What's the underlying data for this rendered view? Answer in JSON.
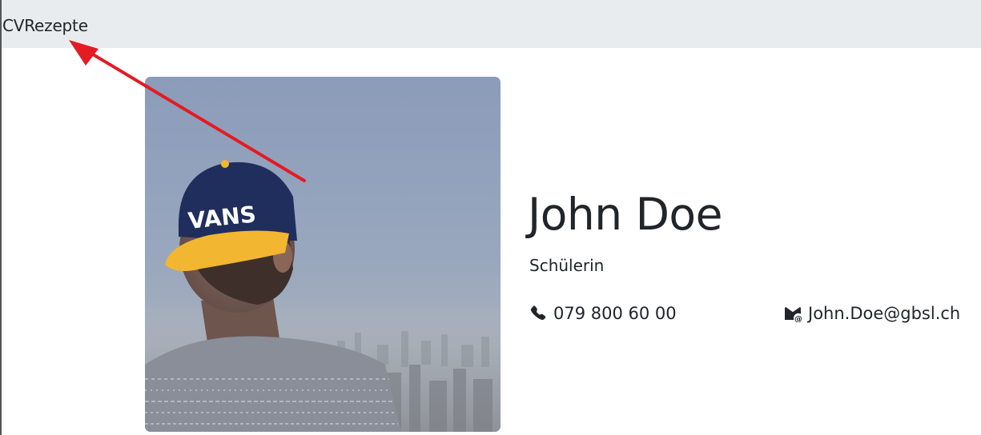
{
  "navbar": {
    "brand": "CVRezepte"
  },
  "profile": {
    "photo_icon": "profile-photo",
    "cap_text": "VANS",
    "name": "John Doe",
    "role": "Schülerin",
    "phone": "079 800 60 00",
    "email": "John.Doe@gbsl.ch",
    "phone_icon": "phone-icon",
    "email_icon": "envelope-at-icon"
  },
  "annotation": {
    "arrow_color": "#e31b23"
  },
  "colors": {
    "navbar_bg": "#e9ecef",
    "text": "#212529",
    "sky_top": "#8fa0bd",
    "cap_navy": "#1f2e5c",
    "cap_brim": "#f2b630"
  }
}
